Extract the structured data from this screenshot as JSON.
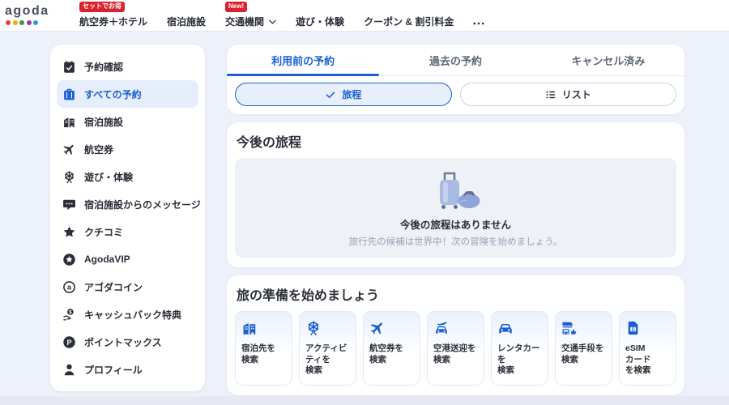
{
  "header": {
    "logo_text": "agoda",
    "logo_dot_colors": [
      "#e93f33",
      "#f7a80a",
      "#3f9b35",
      "#9b3a96",
      "#2ba0d8"
    ],
    "nav": [
      {
        "label": "航空券＋ホテル",
        "badge": "セットでお得"
      },
      {
        "label": "宿泊施設"
      },
      {
        "label": "交通機関",
        "badge": "New!",
        "has_chevron": true
      },
      {
        "label": "遊び・体験"
      },
      {
        "label": "クーポン & 割引料金"
      },
      {
        "icon": "more-menu"
      }
    ]
  },
  "sidebar": {
    "items": [
      {
        "label": "予約確認",
        "icon": "calendar-check-icon",
        "active": false
      },
      {
        "label": "すべての予約",
        "icon": "suitcase-icon",
        "active": true
      },
      {
        "label": "宿泊施設",
        "icon": "buildings-icon",
        "active": false
      },
      {
        "label": "航空券",
        "icon": "plane-icon",
        "active": false
      },
      {
        "label": "遊び・体験",
        "icon": "ferris-wheel-icon",
        "active": false
      },
      {
        "label": "宿泊施設からのメッセージ",
        "icon": "message-icon",
        "active": false
      },
      {
        "label": "クチコミ",
        "icon": "star-icon",
        "active": false
      },
      {
        "label": "AgodaVIP",
        "icon": "star-circle-icon",
        "active": false
      },
      {
        "label": "アゴダコイン",
        "icon": "coin-a-icon",
        "active": false
      },
      {
        "label": "キャッシュバック特典",
        "icon": "cashback-icon",
        "active": false
      },
      {
        "label": "ポイントマックス",
        "icon": "pointsmax-icon",
        "active": false
      },
      {
        "label": "プロフィール",
        "icon": "profile-icon",
        "active": false
      }
    ]
  },
  "main": {
    "tabs": [
      {
        "label": "利用前の予約",
        "active": true
      },
      {
        "label": "過去の予約",
        "active": false
      },
      {
        "label": "キャンセル済み",
        "active": false
      }
    ],
    "view_toggle": [
      {
        "label": "旅程",
        "icon": "check-icon",
        "active": true
      },
      {
        "label": "リスト",
        "icon": "list-icon",
        "active": false
      }
    ],
    "upcoming_section": {
      "title": "今後の旅程",
      "empty_title": "今後の旅程はありません",
      "empty_subtitle": "旅行先の候補は世界中！次の冒険を始めましょう。",
      "illustration": "luggage-illustration"
    },
    "prepare_section": {
      "title": "旅の準備を始めましょう",
      "cards": [
        {
          "label": "宿泊先を\n検索",
          "icon": "buildings-icon"
        },
        {
          "label": "アクティビ\nティを\n検索",
          "icon": "ferris-wheel-icon"
        },
        {
          "label": "航空券を\n検索",
          "icon": "plane-icon"
        },
        {
          "label": "空港送迎を\n検索",
          "icon": "airport-transfer-icon"
        },
        {
          "label": "レンタカー\nを\n検索",
          "icon": "car-icon"
        },
        {
          "label": "交通手段を\n検索",
          "icon": "transport-icon"
        },
        {
          "label": "eSIM\nカード\nを検索",
          "icon": "sim-card-icon"
        }
      ]
    }
  },
  "colors": {
    "accent_blue": "#1d5fd2",
    "badge_red": "#dc212e",
    "page_bg": "#edf1f9",
    "active_item_bg": "#e7eefb",
    "empty_box_bg": "#eef1f6"
  }
}
